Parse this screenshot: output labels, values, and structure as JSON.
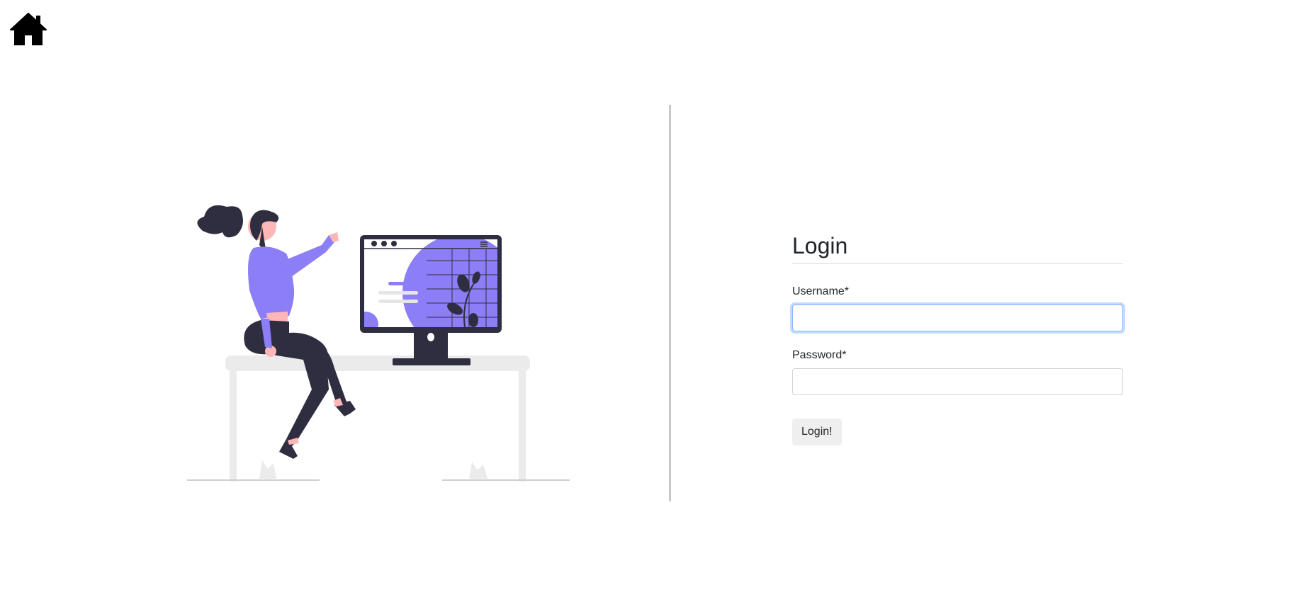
{
  "nav": {
    "home_icon": "home-icon"
  },
  "illustration": {
    "description_icon": "woman-at-desk-illustration",
    "accent_color": "#8c7ef6",
    "dark_color": "#2f2e41"
  },
  "login": {
    "title": "Login",
    "username_label": "Username*",
    "username_value": "",
    "password_label": "Password*",
    "password_value": "",
    "submit_label": "Login!"
  },
  "colors": {
    "input_focus_border": "#86b7fe",
    "button_bg": "#efefef",
    "divider": "#c8c8c8"
  }
}
